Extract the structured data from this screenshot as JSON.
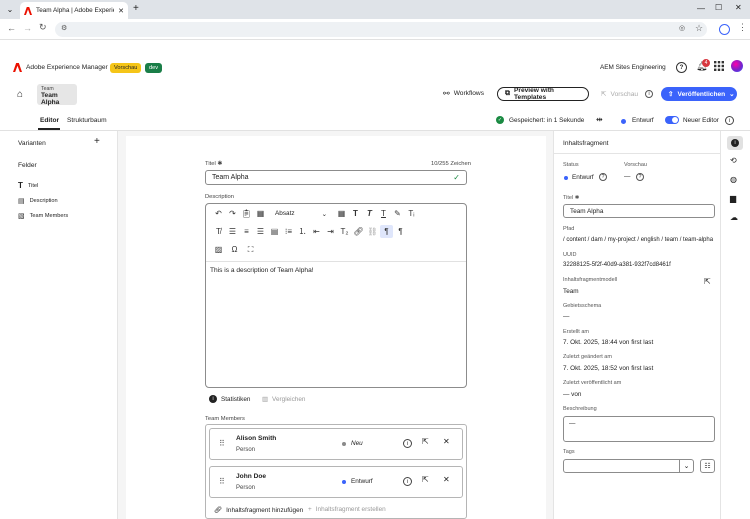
{
  "browser": {
    "tab_title": "Team Alpha | Adobe Experience",
    "new_tab": "+"
  },
  "aem": {
    "product": "Adobe Experience Manager",
    "badge_preview": "Vorschau",
    "badge_dev": "dev",
    "org": "AEM Sites Engineering",
    "notification_count": "4"
  },
  "fragment_header": {
    "type_label": "Team",
    "title": "Team Alpha",
    "workflows": "Workflows",
    "preview_templates": "Preview with Templates",
    "preview": "Vorschau",
    "publish": "Veröffentlichen"
  },
  "subnav": {
    "tab_editor": "Editor",
    "tab_structure": "Strukturbaum",
    "saved": "Gespeichert: in 1 Sekunde",
    "draft": "Entwurf",
    "new_editor": "Neuer Editor"
  },
  "left": {
    "variants": "Varianten",
    "fields": "Felder",
    "items": [
      "Titel",
      "Description",
      "Team Members"
    ]
  },
  "form": {
    "title_label": "Titel",
    "title_counter": "10/255 Zeichen",
    "title_value": "Team Alpha",
    "description_label": "Description",
    "paragraph_format": "Absatz",
    "description_text": "This is a description of Team Alpha!",
    "stats": "Statistiken",
    "compare": "Vergleichen",
    "members_label": "Team Members",
    "members": [
      {
        "name": "Alison Smith",
        "type": "Person",
        "status": "Neu",
        "status_color": "#8a8a8a"
      },
      {
        "name": "John Doe",
        "type": "Person",
        "status": "Entwurf",
        "status_color": "#3b63fb"
      }
    ],
    "add_fragment": "Inhaltsfragment hinzufügen",
    "create_fragment": "Inhaltsfragment erstellen"
  },
  "right": {
    "heading": "Inhaltsfragment",
    "status_label": "Status",
    "status_value": "Entwurf",
    "preview_label": "Vorschau",
    "preview_value": "—",
    "title_label": "Titel",
    "title_value": "Team Alpha",
    "path_label": "Pfad",
    "path_value": "/ content / dam / my-project / english / team / team-alpha",
    "uuid_label": "UUID",
    "uuid_value": "32288125-5f2f-40d9-a381-932f7cd8461f",
    "model_label": "Inhaltsfragmentmodell",
    "model_value": "Team",
    "schema_label": "Gebietsschema",
    "schema_value": "—",
    "created_label": "Erstellt am",
    "created_value": "7. Okt. 2025, 18:44 von first last",
    "modified_label": "Zuletzt geändert am",
    "modified_value": "7. Okt. 2025, 18:52 von first last",
    "published_label": "Zuletzt veröffentlicht am",
    "published_value": "— von",
    "desc_label": "Beschreibung",
    "desc_value": "—",
    "tags_label": "Tags"
  },
  "colors": {
    "accent": "#3b63fb",
    "badge_yellow": "#f5c518",
    "badge_green": "#1a7e48",
    "adobe_red": "#eb1000",
    "saved_green": "#1a8a42"
  }
}
